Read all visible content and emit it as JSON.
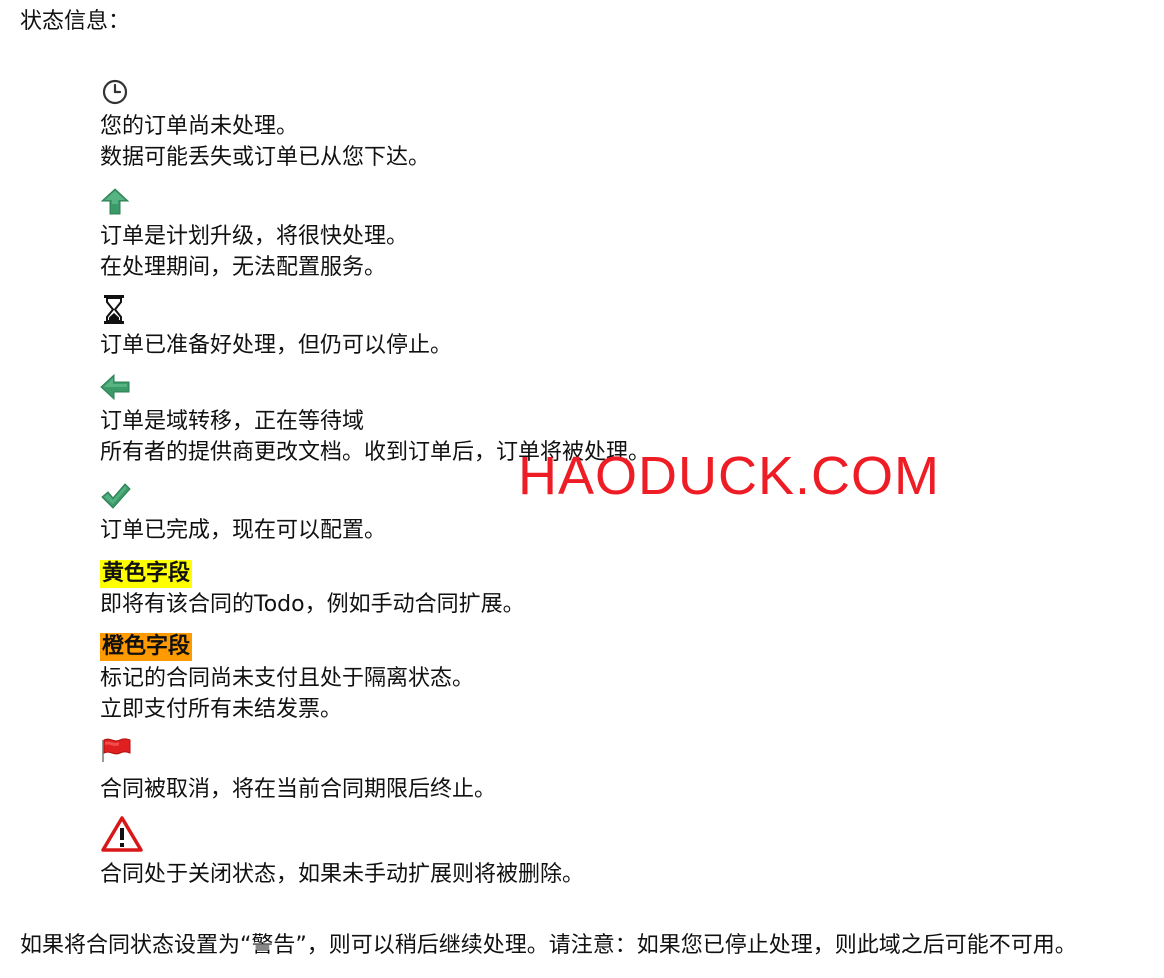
{
  "heading": "状态信息：",
  "status_items": [
    {
      "icon": "clock-icon",
      "lines": [
        "您的订单尚未处理。",
        "数据可能丢失或订单已从您下达。"
      ]
    },
    {
      "icon": "arrow-up-icon",
      "lines": [
        "订单是计划升级，将很快处理。",
        "在处理期间，无法配置服务。"
      ]
    },
    {
      "icon": "hourglass-icon",
      "lines": [
        "订单已准备好处理，但仍可以停止。"
      ]
    },
    {
      "icon": "arrow-left-icon",
      "lines": [
        "订单是域转移，正在等待域",
        "所有者的提供商更改文档。收到订单后，订单将被处理。"
      ]
    },
    {
      "icon": "checkmark-icon",
      "lines": [
        "订单已完成，现在可以配置。"
      ]
    }
  ],
  "field_items": [
    {
      "label": "黄色字段",
      "color": "#ffff00",
      "lines": [
        "即将有该合同的Todo，例如手动合同扩展。"
      ]
    },
    {
      "label": "橙色字段",
      "color": "#ff9a00",
      "lines": [
        "标记的合同尚未支付且处于隔离状态。",
        "立即支付所有未结发票。"
      ]
    }
  ],
  "contract_items": [
    {
      "icon": "red-flag-icon",
      "lines": [
        "合同被取消，将在当前合同期限后终止。"
      ]
    },
    {
      "icon": "warning-triangle-icon",
      "lines": [
        "合同处于关闭状态，如果未手动扩展则将被删除。"
      ]
    }
  ],
  "footer_note": "如果将合同状态设置为“警告”，则可以稍后继续处理。请注意：如果您已停止处理，则此域之后可能不可用。",
  "watermark": "HAODUCK.COM",
  "colors": {
    "text": "#111111",
    "green_icon": "#3a9a68",
    "flag_red": "#e02020",
    "warning_red": "#d81818",
    "watermark_red": "#ee1c25"
  }
}
